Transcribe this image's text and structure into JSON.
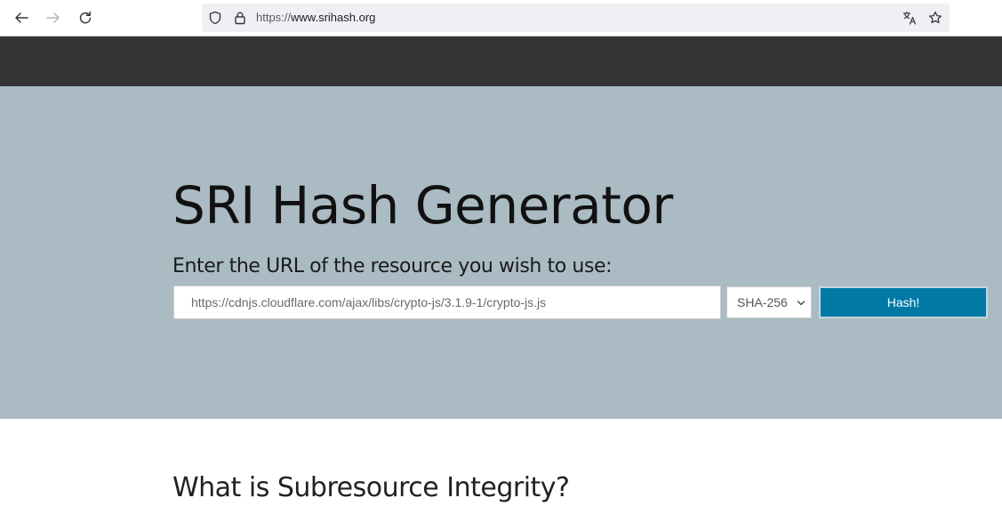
{
  "browser": {
    "url_scheme": "https://",
    "url_host": "www.srihash.org",
    "icons": [
      "back-arrow-icon",
      "forward-arrow-icon",
      "reload-icon",
      "shield-icon",
      "lock-icon",
      "translate-icon",
      "star-icon"
    ]
  },
  "hero": {
    "title": "SRI Hash Generator",
    "subtitle": "Enter the URL of the resource you wish to use:",
    "url_input": {
      "value": "",
      "placeholder": "https://cdnjs.cloudflare.com/ajax/libs/crypto-js/3.1.9-1/crypto-js.js"
    },
    "algorithm": {
      "selected": "SHA-256"
    },
    "hash_button_label": "Hash!"
  },
  "content": {
    "heading": "What is Subresource Integrity?"
  },
  "colors": {
    "site_nav_bg": "#333333",
    "hero_bg": "#aabbc3",
    "button_bg": "#0079a5",
    "url_bar_bg": "#f0f0f4"
  }
}
